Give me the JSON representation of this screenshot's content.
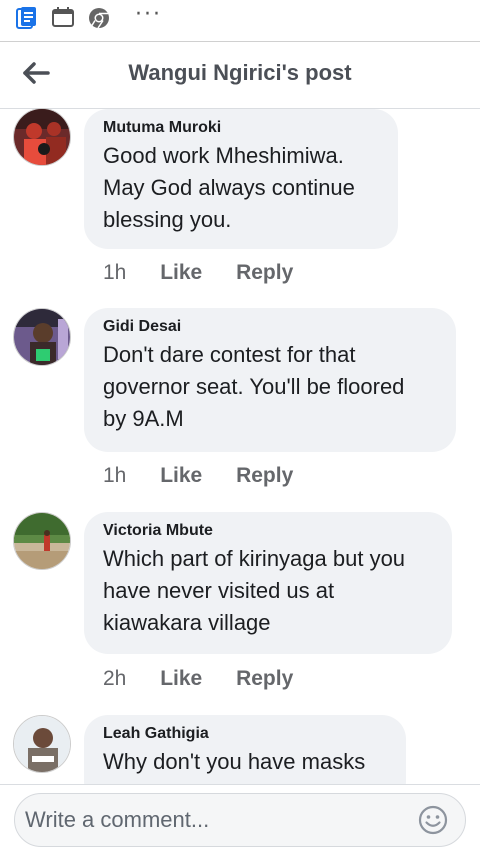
{
  "header": {
    "title": "Wangui Ngirici's post"
  },
  "statusbar": {
    "more": "···"
  },
  "comments": [
    {
      "author": "Mutuma Muroki",
      "text": "Good work Mheshimiwa.\nMay God always continue\nblessing you.",
      "time": "1h",
      "like": "Like",
      "reply": "Reply"
    },
    {
      "author": "Gidi Desai",
      "text": "Don't dare contest for that\ngovernor seat. You'll be floored\nby 9A.M",
      "time": "1h",
      "like": "Like",
      "reply": "Reply"
    },
    {
      "author": "Victoria Mbute",
      "text": "Which part of kirinyaga but you\nhave never visited us at\nkiawakara village",
      "time": "2h",
      "like": "Like",
      "reply": "Reply"
    },
    {
      "author": "Leah Gathigia",
      "text": "Why don't you have masks"
    }
  ],
  "composer": {
    "placeholder": "Write a comment..."
  }
}
